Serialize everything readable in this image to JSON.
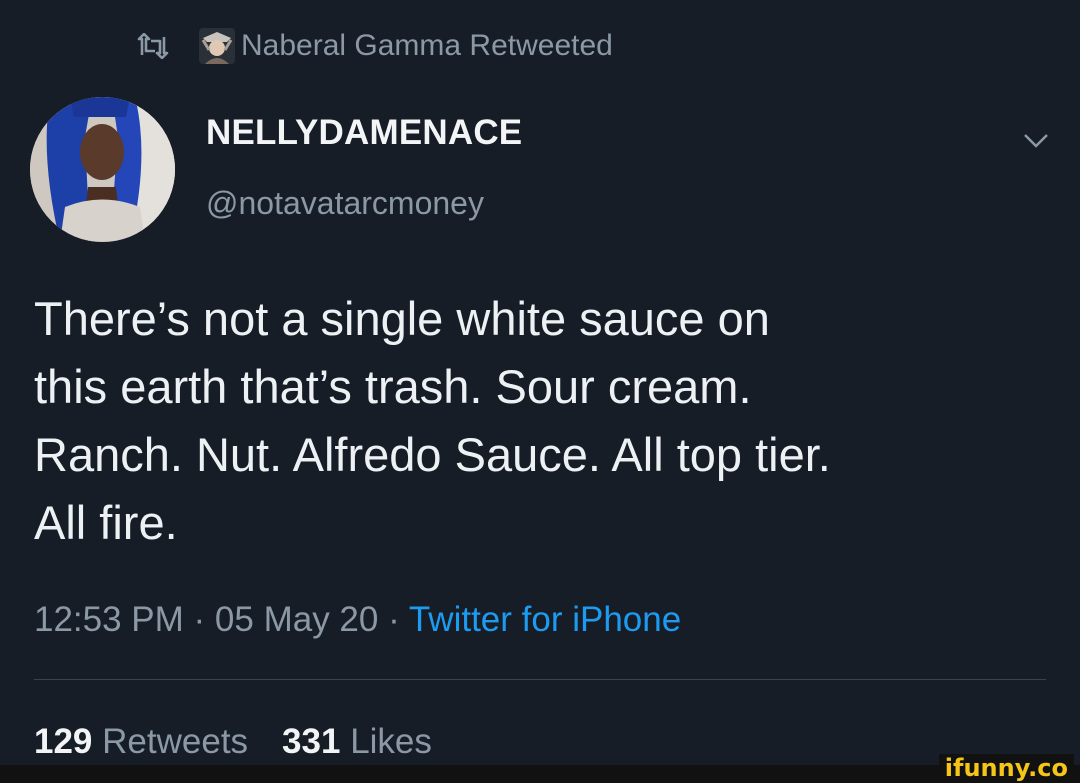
{
  "retweet": {
    "icon": "retweet-icon",
    "text": "Naberal Gamma Retweeted"
  },
  "author": {
    "display_name": "NELLYDAMENACE",
    "handle": "@notavatarcmoney"
  },
  "tweet": {
    "lines": [
      "There’s not a single white sauce on",
      "this earth that’s trash. Sour cream.",
      "Ranch. Nut. Alfredo Sauce. All top tier.",
      "All fire."
    ]
  },
  "meta": {
    "time": "12:53 PM",
    "separator": " · ",
    "date": "05 May 20",
    "source": "Twitter for iPhone"
  },
  "stats": {
    "retweets_count": "129",
    "retweets_label": "Retweets",
    "likes_count": "331",
    "likes_label": "Likes"
  },
  "watermark": "ifunny.co",
  "colors": {
    "background": "#161d27",
    "muted": "#8b98a5",
    "link": "#1d9bf0",
    "watermark": "#f5c518"
  }
}
